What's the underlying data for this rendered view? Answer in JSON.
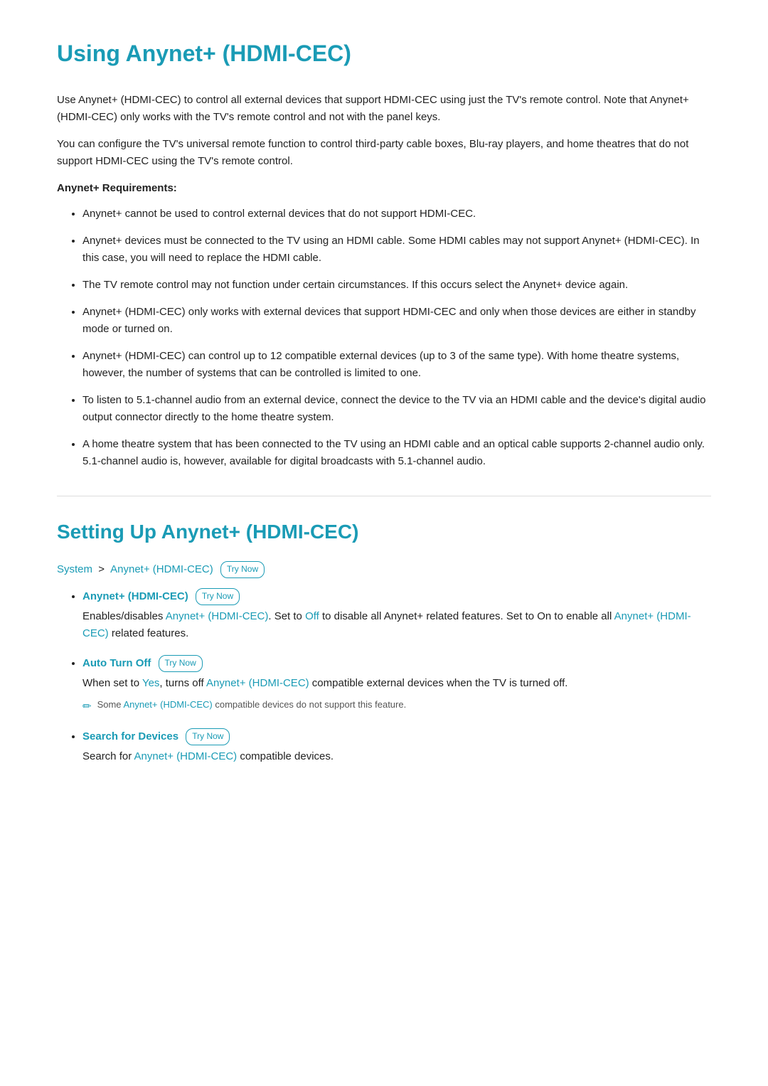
{
  "page": {
    "main_title": "Using Anynet+ (HDMI-CEC)",
    "intro1": "Use Anynet+ (HDMI-CEC) to control all external devices that support HDMI-CEC using just the TV's remote control. Note that Anynet+ (HDMI-CEC) only works with the TV's remote control and not with the panel keys.",
    "intro2": "You can configure the TV's universal remote function to control third-party cable boxes, Blu-ray players, and home theatres that do not support HDMI-CEC using the TV's remote control.",
    "requirements_heading": "Anynet+ Requirements:",
    "bullets": [
      "Anynet+ cannot be used to control external devices that do not support HDMI-CEC.",
      "Anynet+ devices must be connected to the TV using an HDMI cable. Some HDMI cables may not support Anynet+ (HDMI-CEC). In this case, you will need to replace the HDMI cable.",
      "The TV remote control may not function under certain circumstances. If this occurs select the Anynet+ device again.",
      "Anynet+ (HDMI-CEC) only works with external devices that support HDMI-CEC and only when those devices are either in standby mode or turned on.",
      "Anynet+ (HDMI-CEC) can control up to 12 compatible external devices (up to 3 of the same type). With home theatre systems, however, the number of systems that can be controlled is limited to one.",
      "To listen to 5.1-channel audio from an external device, connect the device to the TV via an HDMI cable and the device's digital audio output connector directly to the home theatre system.",
      "A home theatre system that has been connected to the TV using an HDMI cable and an optical cable supports 2-channel audio only. 5.1-channel audio is, however, available for digital broadcasts with 5.1-channel audio."
    ],
    "section2_title": "Setting Up Anynet+ (HDMI-CEC)",
    "breadcrumb": {
      "part1": "System",
      "separator": ">",
      "part2": "Anynet+ (HDMI-CEC)",
      "badge": "Try Now"
    },
    "settings": [
      {
        "label": "Anynet+ (HDMI-CEC)",
        "badge": "Try Now",
        "description_parts": [
          "Enables/disables ",
          "Anynet+ (HDMI-CEC)",
          ". Set to ",
          "Off",
          " to disable all Anynet+ related features. Set to On to enable all ",
          "Anynet+ (HDMI-CEC)",
          " related features."
        ],
        "has_note": false
      },
      {
        "label": "Auto Turn Off",
        "badge": "Try Now",
        "description_parts": [
          "When set to ",
          "Yes",
          ", turns off ",
          "Anynet+ (HDMI-CEC)",
          " compatible external devices when the TV is turned off."
        ],
        "has_note": true,
        "note": "Some Anynet+ (HDMI-CEC) compatible devices do not support this feature."
      },
      {
        "label": "Search for Devices",
        "badge": "Try Now",
        "description_parts": [
          "Search for ",
          "Anynet+ (HDMI-CEC)",
          " compatible devices."
        ],
        "has_note": false
      }
    ],
    "try_now_label": "Try Now"
  }
}
